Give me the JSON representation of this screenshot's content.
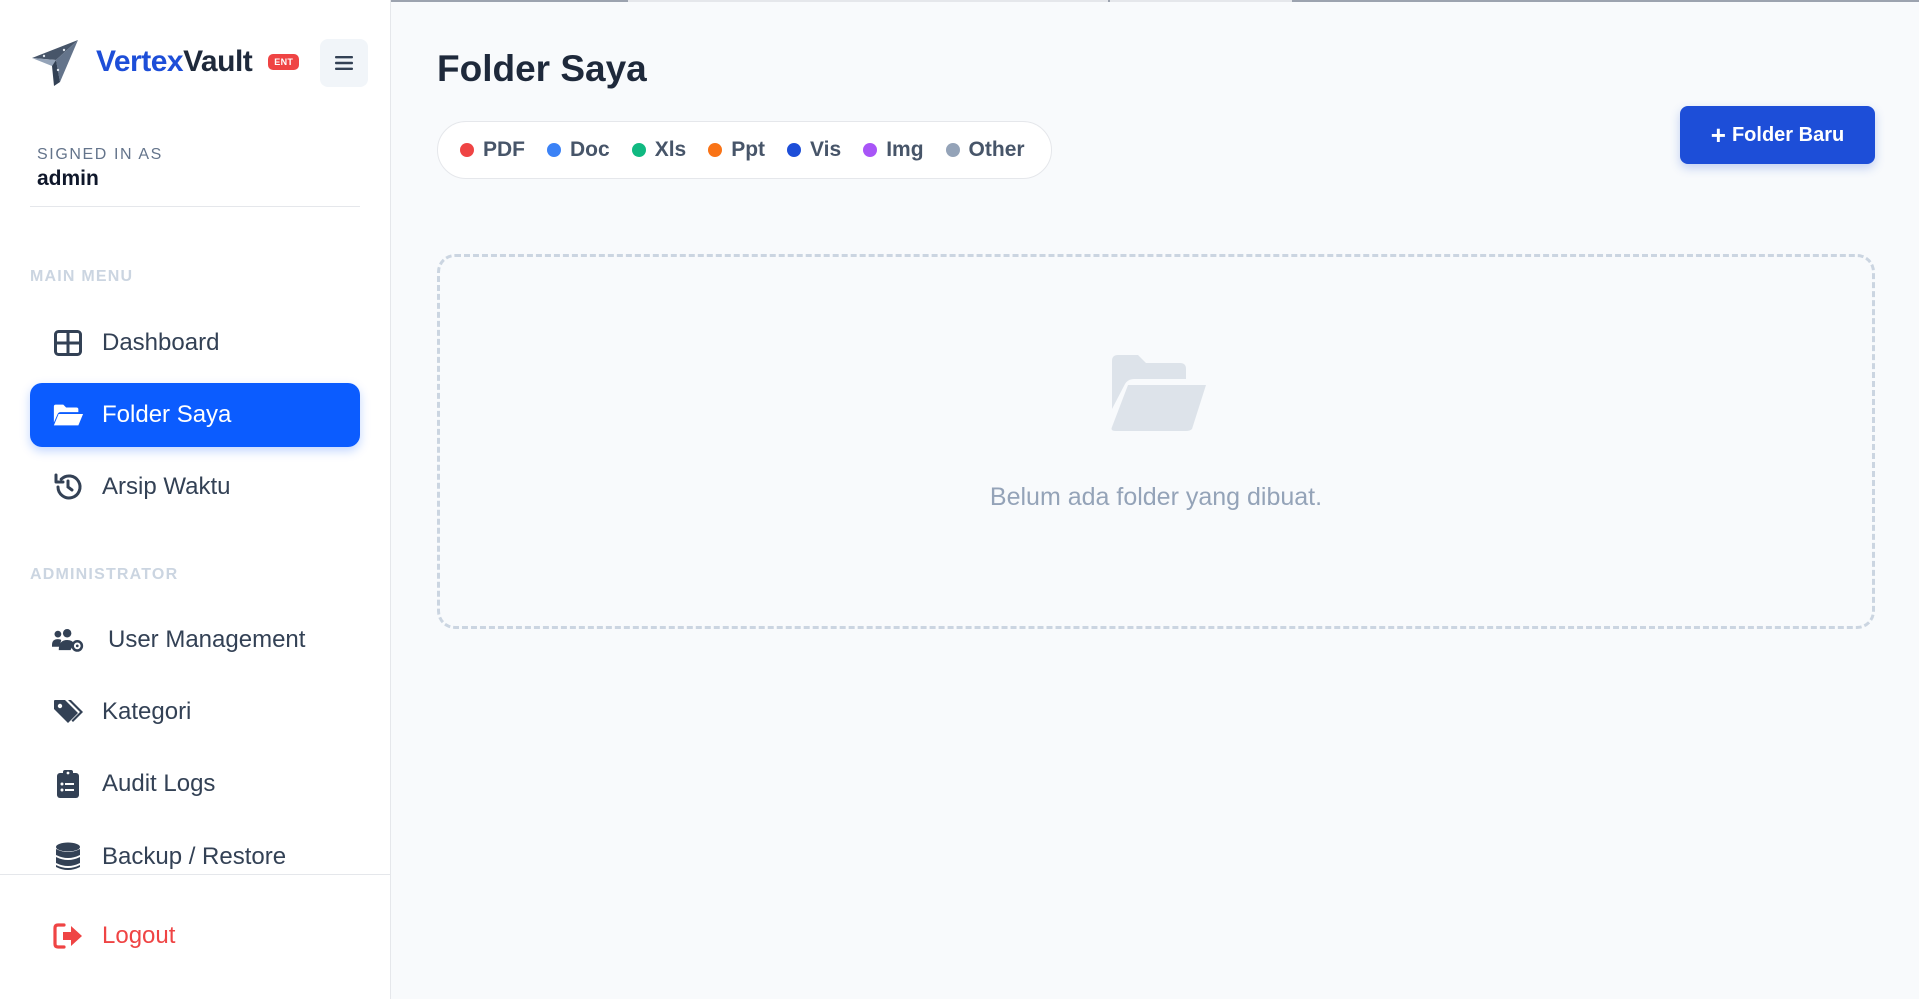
{
  "brand": {
    "name_part1": "Vertex",
    "name_part2": "Vault",
    "badge": "ENT"
  },
  "user": {
    "signed_in_label": "SIGNED IN AS",
    "username": "admin"
  },
  "sidebar": {
    "main_menu_title": "MAIN MENU",
    "main_items": [
      {
        "label": "Dashboard",
        "icon": "dashboard-grid-icon"
      },
      {
        "label": "Folder Saya",
        "icon": "folder-open-icon",
        "active": true
      },
      {
        "label": "Arsip Waktu",
        "icon": "history-icon"
      }
    ],
    "admin_title": "ADMINISTRATOR",
    "admin_items": [
      {
        "label": "User Management",
        "icon": "users-cog-icon"
      },
      {
        "label": "Kategori",
        "icon": "tags-icon"
      },
      {
        "label": "Audit Logs",
        "icon": "clipboard-list-icon"
      },
      {
        "label": "Backup / Restore",
        "icon": "database-icon"
      }
    ],
    "logout_label": "Logout"
  },
  "main": {
    "title": "Folder Saya",
    "new_folder_button": "Folder Baru",
    "legend": [
      {
        "label": "PDF",
        "color": "#ef4444"
      },
      {
        "label": "Doc",
        "color": "#3b82f6"
      },
      {
        "label": "Xls",
        "color": "#10b981"
      },
      {
        "label": "Ppt",
        "color": "#f97316"
      },
      {
        "label": "Vis",
        "color": "#1d4ed8"
      },
      {
        "label": "Img",
        "color": "#a855f7"
      },
      {
        "label": "Other",
        "color": "#94a3b8"
      }
    ],
    "empty_message": "Belum ada folder yang dibuat."
  },
  "colors": {
    "accent": "#0b5cff",
    "danger": "#ef4444",
    "muted": "#94a3b8"
  }
}
